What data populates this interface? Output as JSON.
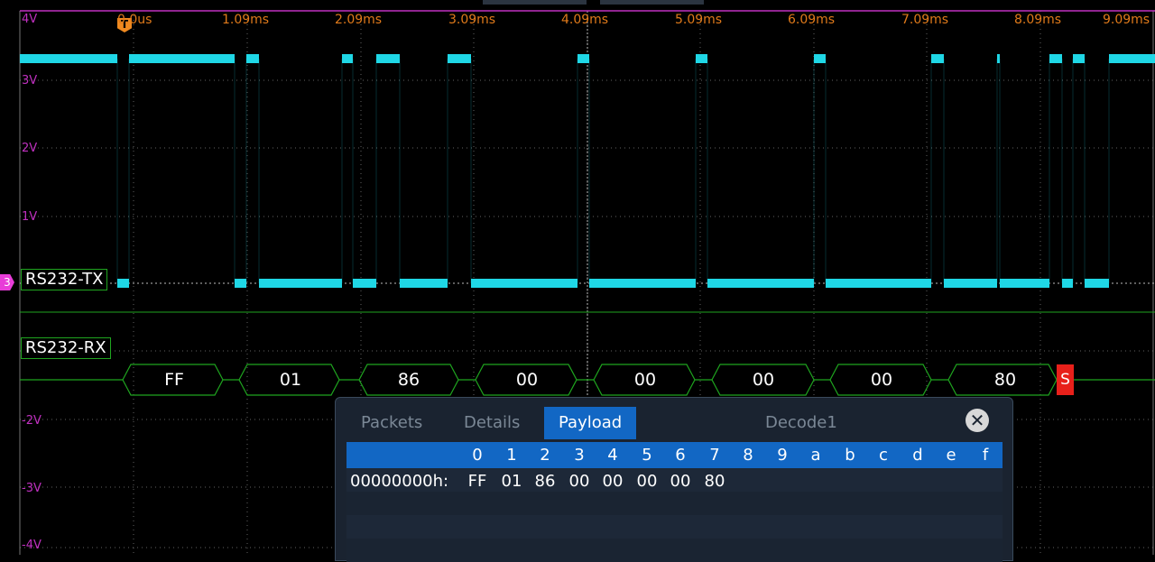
{
  "time_axis": {
    "labels": [
      "0.0us",
      "1.09ms",
      "2.09ms",
      "3.09ms",
      "4.09ms",
      "5.09ms",
      "6.09ms",
      "7.09ms",
      "8.09ms",
      "9.09ms"
    ]
  },
  "voltage_axis": {
    "labels": [
      "4V",
      "3V",
      "2V",
      "1V",
      "-2V",
      "-3V",
      "-4V"
    ]
  },
  "trigger": {
    "label": "T"
  },
  "channel_marker": {
    "label": "3"
  },
  "channels": {
    "tx_label": "RS232-TX",
    "rx_label": "RS232-RX"
  },
  "decode": {
    "bytes": [
      "FF",
      "01",
      "86",
      "00",
      "00",
      "00",
      "00",
      "80"
    ],
    "stop_marker": "S"
  },
  "panel": {
    "tabs": [
      "Packets",
      "Details",
      "Payload"
    ],
    "active_tab": "Payload",
    "title": "Decode1",
    "close_icon": "close-icon",
    "hex_columns": [
      "0",
      "1",
      "2",
      "3",
      "4",
      "5",
      "6",
      "7",
      "8",
      "9",
      "a",
      "b",
      "c",
      "d",
      "e",
      "f"
    ],
    "row_address": "00000000h:",
    "row_values": [
      "FF",
      "01",
      "86",
      "00",
      "00",
      "00",
      "00",
      "80"
    ]
  },
  "colors": {
    "trace": "#1fd7e6",
    "grid": "#8c8c8c",
    "decode": "#1fa51f",
    "time_label": "#e07a1a",
    "volt_label": "#c030c0",
    "active_tab": "#1267c4"
  }
}
